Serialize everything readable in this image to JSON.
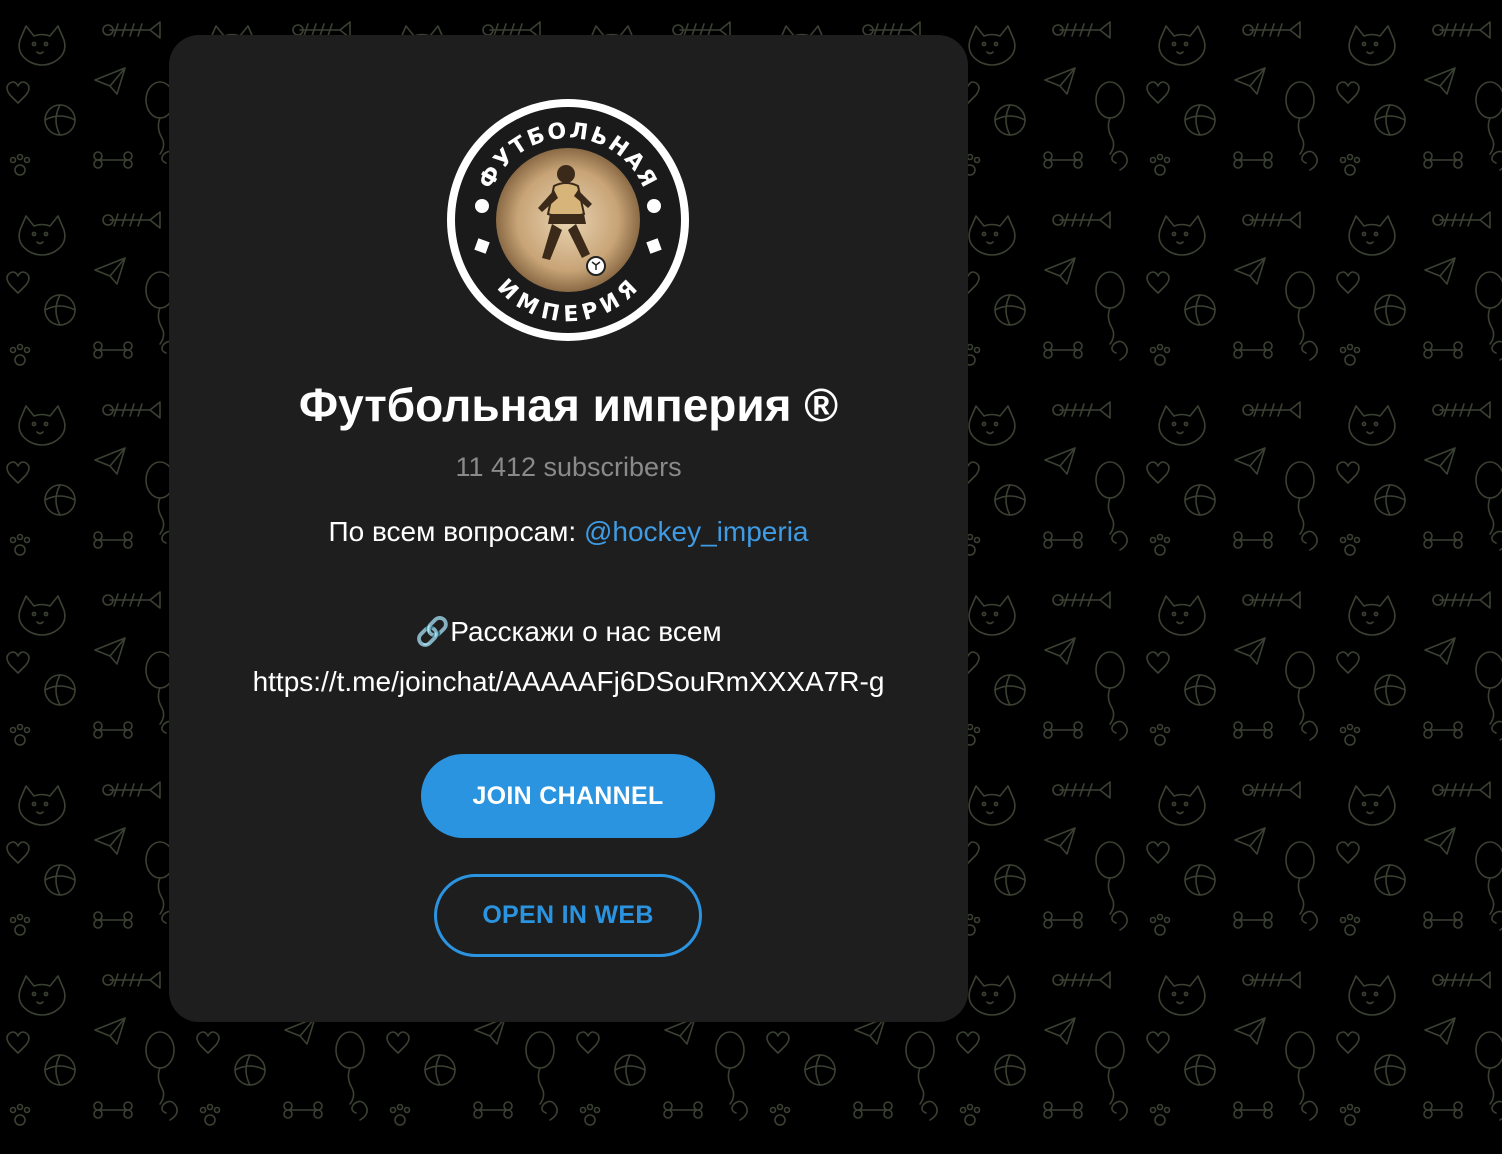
{
  "channel": {
    "title": "Футбольная империя ®",
    "subscribers": "11 412 subscribers",
    "avatar_text_top": "ФУТБОЛЬНАЯ",
    "avatar_text_bottom": "ИМПЕРИЯ"
  },
  "description": {
    "line1_prefix": "По всем вопросам: ",
    "line1_link": "@hockey_imperia",
    "line2_icon": "🔗",
    "line2_text": "Расскажи о нас всем",
    "line3_url": "https://t.me/joinchat/AAAAAFj6DSouRmXXXA7R-g"
  },
  "buttons": {
    "join": "JOIN CHANNEL",
    "open_web": "OPEN IN WEB"
  },
  "colors": {
    "accent": "#2b94e0",
    "link": "#3e9be4",
    "card_bg": "#1e1e1e",
    "page_bg": "#000000",
    "muted_text": "#8a8a8a"
  }
}
